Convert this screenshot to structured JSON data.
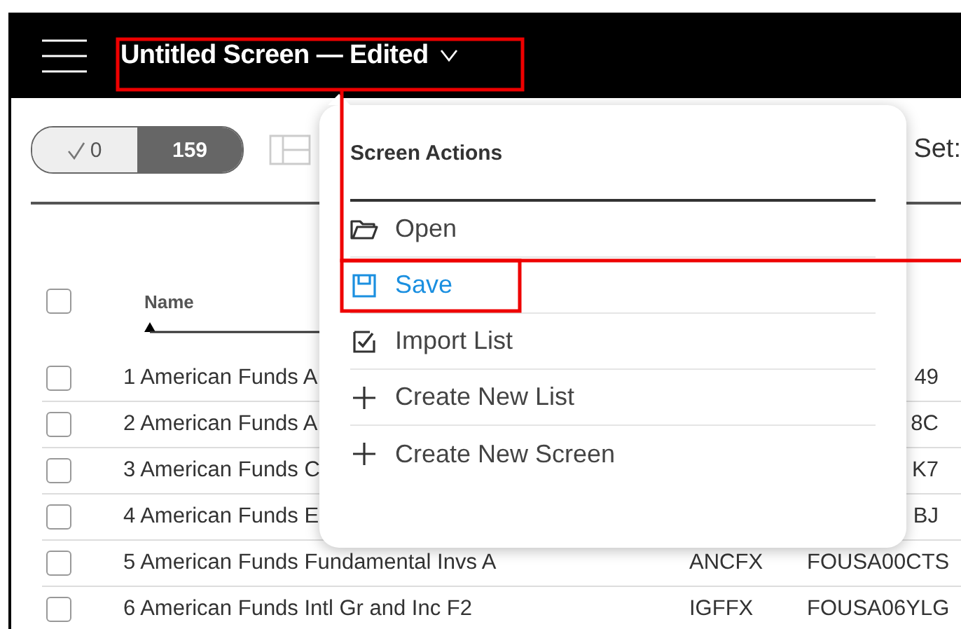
{
  "top_bar": {
    "title": "Untitled Screen — Edited"
  },
  "toolbar": {
    "toggle": [
      {
        "kind": "check",
        "label": "0",
        "selected": false
      },
      {
        "kind": "count",
        "label": "159",
        "selected": true
      }
    ],
    "set_label": "Set:"
  },
  "table": {
    "header_checked": false,
    "columns": [
      "Name"
    ],
    "rows": [
      {
        "number": "1",
        "name": "American Funds A",
        "id": "49",
        "checked": false
      },
      {
        "number": "2",
        "name": "American Funds A",
        "id": "8C",
        "checked": false
      },
      {
        "number": "3",
        "name": "American Funds C",
        "id": "K7",
        "checked": false
      },
      {
        "number": "4",
        "name": "American Funds E",
        "id": "BJ",
        "checked": false
      },
      {
        "number": "5",
        "name": "American Funds Fundamental Invs A",
        "ticker": "ANCFX",
        "id": "FOUSA00CTS",
        "checked": false
      },
      {
        "number": "6",
        "name": "American Funds Intl Gr and Inc F2",
        "ticker": "IGFFX",
        "id": "FOUSA06YLG",
        "checked": false
      }
    ]
  },
  "menu": {
    "title": "Screen Actions",
    "items": [
      {
        "label": "Open",
        "kind": "folder",
        "selected": false
      },
      {
        "label": "Save",
        "kind": "save",
        "selected": true
      },
      {
        "label": "Import List",
        "kind": "import",
        "selected": false
      },
      {
        "label": "Create New List",
        "kind": "create",
        "selected": false
      },
      {
        "label": "Create New Screen",
        "kind": "create",
        "selected": false
      }
    ]
  }
}
